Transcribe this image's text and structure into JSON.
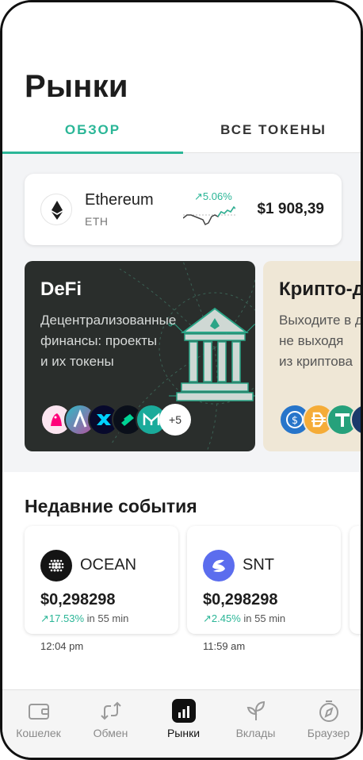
{
  "header": {
    "title": "Рынки",
    "tabs": [
      {
        "label": "ОБЗОР",
        "active": true
      },
      {
        "label": "ВСЕ ТОКЕНЫ",
        "active": false
      }
    ]
  },
  "featured_token": {
    "name": "Ethereum",
    "symbol": "ETH",
    "change": "5.06%",
    "change_direction": "up",
    "price": "$1 908,39",
    "icon": "ethereum-icon"
  },
  "promos": [
    {
      "title": "DeFi",
      "description_lines": [
        "Децентрализованные",
        "финансы: проекты",
        "и их токены"
      ],
      "more_count": "+5",
      "coin_icons": [
        "uniswap-icon",
        "aave-icon",
        "synthetix-icon",
        "compound-icon",
        "maker-icon"
      ]
    },
    {
      "title": "Крипто-д",
      "description_lines": [
        "Выходите в д",
        "не выходя",
        "из криптова"
      ],
      "coin_icons": [
        "usdc-icon",
        "dai-icon",
        "tether-icon",
        "other-stablecoin-icon"
      ]
    }
  ],
  "events": {
    "title": "Недавние события",
    "items": [
      {
        "name": "OCEAN",
        "price": "$0,298298",
        "change": "17.53%",
        "period": "in 55 min",
        "time": "12:04 pm",
        "icon": "ocean-icon"
      },
      {
        "name": "SNT",
        "price": "$0,298298",
        "change": "2.45%",
        "period": "in 55 min",
        "time": "11:59 am",
        "icon": "snt-icon"
      }
    ]
  },
  "nav": {
    "items": [
      {
        "label": "Кошелек",
        "icon": "wallet-icon",
        "active": false
      },
      {
        "label": "Обмен",
        "icon": "swap-icon",
        "active": false
      },
      {
        "label": "Рынки",
        "icon": "markets-icon",
        "active": true
      },
      {
        "label": "Вклады",
        "icon": "sprout-icon",
        "active": false
      },
      {
        "label": "Браузер",
        "icon": "compass-icon",
        "active": false
      }
    ]
  },
  "colors": {
    "accent": "#2bb697",
    "defi_bg": "#2a2e2c",
    "crypto_bg": "#efe7d6"
  }
}
